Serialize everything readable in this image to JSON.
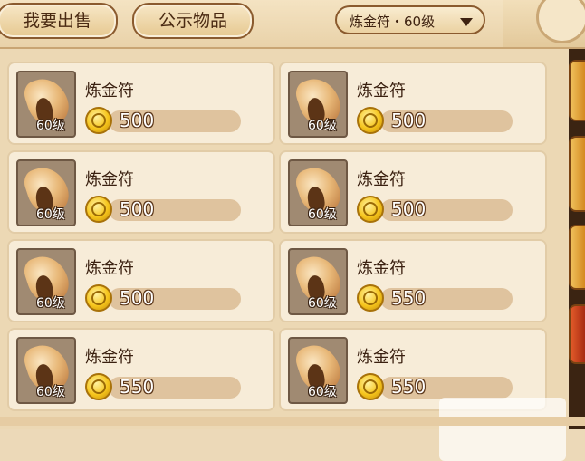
{
  "tabs": {
    "sell": "我要出售",
    "public": "公示物品"
  },
  "filter": {
    "label": "炼金符・60级"
  },
  "listings": [
    {
      "name": "炼金符",
      "level": "60级",
      "price": "500"
    },
    {
      "name": "炼金符",
      "level": "60级",
      "price": "500"
    },
    {
      "name": "炼金符",
      "level": "60级",
      "price": "500"
    },
    {
      "name": "炼金符",
      "level": "60级",
      "price": "500"
    },
    {
      "name": "炼金符",
      "level": "60级",
      "price": "500"
    },
    {
      "name": "炼金符",
      "level": "60级",
      "price": "550"
    },
    {
      "name": "炼金符",
      "level": "60级",
      "price": "550"
    },
    {
      "name": "炼金符",
      "level": "60级",
      "price": "550"
    }
  ],
  "icons": {
    "item": "alchemy-talisman-icon",
    "currency": "gold-coin-icon",
    "dropdown": "triangle-down-icon"
  },
  "colors": {
    "background": "#ecd9b8",
    "card": "#f7ecd8",
    "button_border": "#8a5a2e",
    "coin": "#f6c51c"
  }
}
